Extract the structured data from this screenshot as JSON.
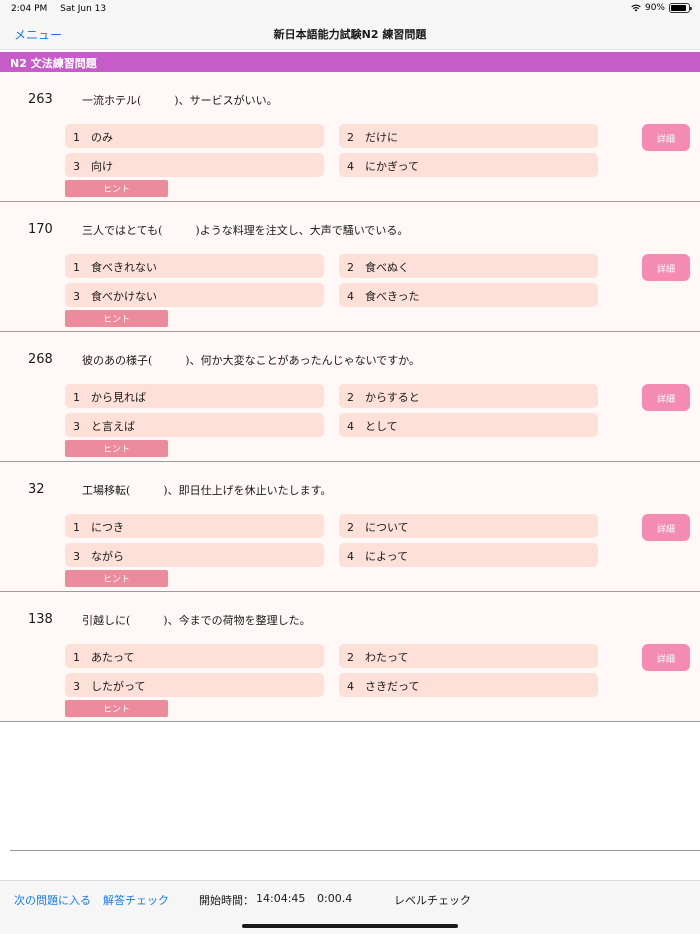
{
  "status_bar": {
    "time": "2:04 PM",
    "date": "Sat Jun 13",
    "battery": "90%"
  },
  "nav": {
    "menu_label": "メニュー",
    "title": "新日本語能力試験N2 練習問題"
  },
  "section": {
    "title": "N2 文法練習問題"
  },
  "labels": {
    "hint": "ヒント",
    "detail": "詳細"
  },
  "questions": [
    {
      "number": "263",
      "text": "一流ホテル(　　　)、サービスがいい。",
      "options": [
        {
          "n": "1",
          "text": "のみ"
        },
        {
          "n": "2",
          "text": "だけに"
        },
        {
          "n": "3",
          "text": "向け"
        },
        {
          "n": "4",
          "text": "にかぎって"
        }
      ]
    },
    {
      "number": "170",
      "text": "三人ではとても(　　　)ような料理を注文し、大声で騒いでいる。",
      "options": [
        {
          "n": "1",
          "text": "食べきれない"
        },
        {
          "n": "2",
          "text": "食べぬく"
        },
        {
          "n": "3",
          "text": "食べかけない"
        },
        {
          "n": "4",
          "text": "食べきった"
        }
      ]
    },
    {
      "number": "268",
      "text": "彼のあの様子(　　　)、何か大変なことがあったんじゃないですか。",
      "options": [
        {
          "n": "1",
          "text": "から見れば"
        },
        {
          "n": "2",
          "text": "からすると"
        },
        {
          "n": "3",
          "text": "と言えば"
        },
        {
          "n": "4",
          "text": "として"
        }
      ]
    },
    {
      "number": "32",
      "text": "工場移転(　　　)、即日仕上げを休止いたします。",
      "options": [
        {
          "n": "1",
          "text": "につき"
        },
        {
          "n": "2",
          "text": "について"
        },
        {
          "n": "3",
          "text": "ながら"
        },
        {
          "n": "4",
          "text": "によって"
        }
      ]
    },
    {
      "number": "138",
      "text": "引越しに(　　　)、今までの荷物を整理した。",
      "options": [
        {
          "n": "1",
          "text": "あたって"
        },
        {
          "n": "2",
          "text": "わたって"
        },
        {
          "n": "3",
          "text": "したがって"
        },
        {
          "n": "4",
          "text": "さきだって"
        }
      ]
    }
  ],
  "toolbar": {
    "next_label": "次の問題に入る",
    "check_label": "解答チェック",
    "start_label": "開始時間：",
    "start_time": "14:04:45",
    "elapsed": "0:00.4",
    "level_label": "レベルチェック"
  }
}
